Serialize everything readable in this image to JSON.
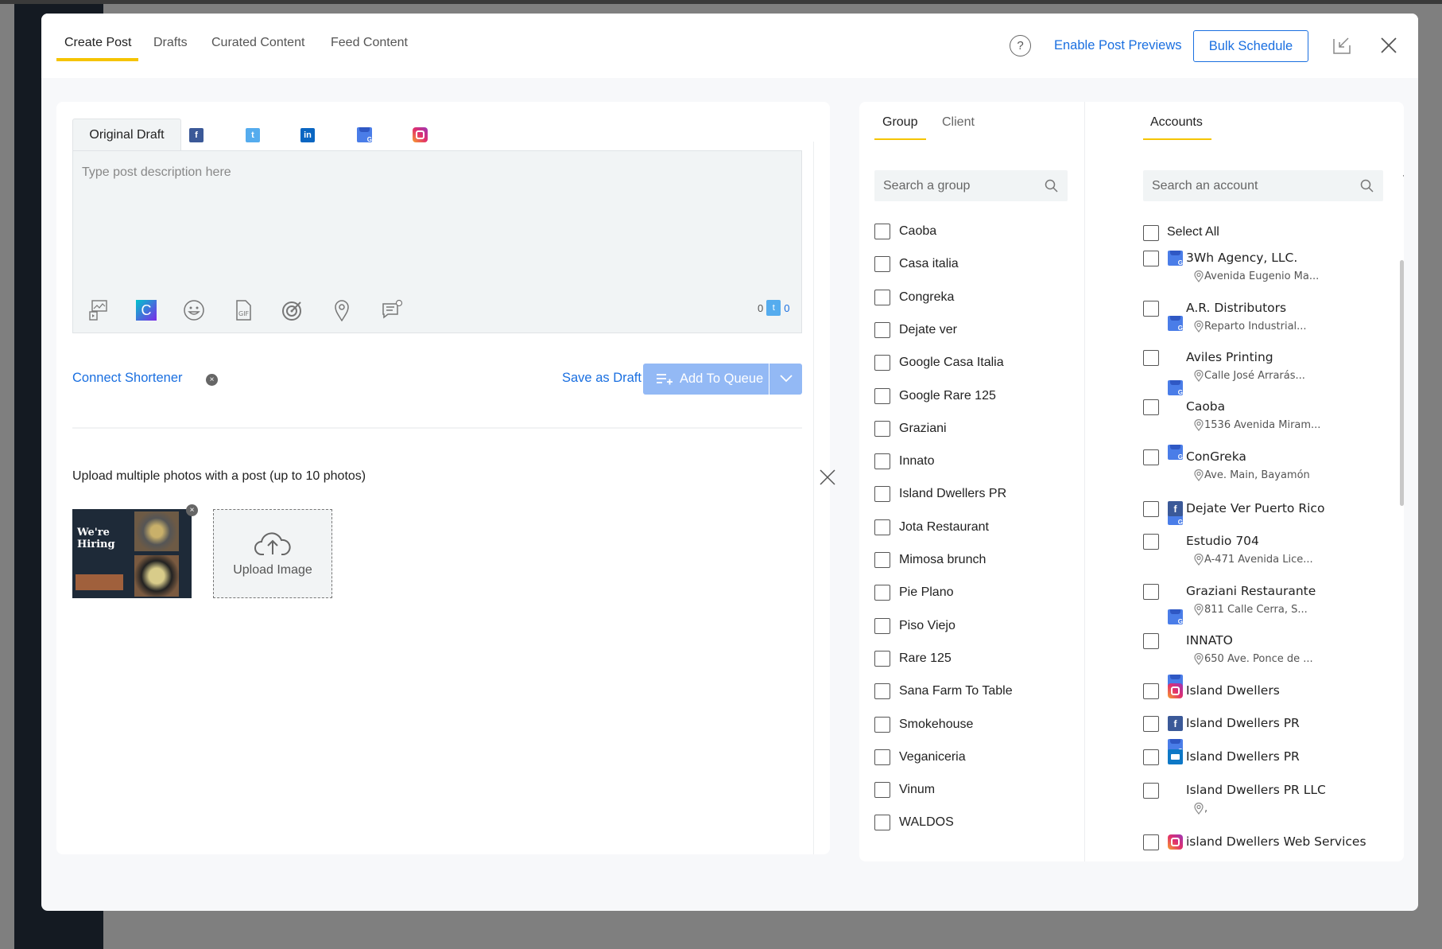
{
  "header": {
    "tabs": [
      {
        "label": "Create Post",
        "active": true
      },
      {
        "label": "Drafts"
      },
      {
        "label": "Curated Content"
      },
      {
        "label": "Feed Content"
      }
    ],
    "enable_previews": "Enable Post Previews",
    "bulk_schedule": "Bulk Schedule"
  },
  "composer": {
    "draft_tab": "Original Draft",
    "network_tabs": [
      "facebook",
      "twitter",
      "linkedin",
      "google-business",
      "instagram"
    ],
    "placeholder": "Type post description here",
    "counter_left": "0",
    "counter_right": "0",
    "connect_shortener": "Connect Shortener",
    "save_draft": "Save as Draft",
    "add_to_queue": "Add To Queue"
  },
  "upload": {
    "title": "Upload multiple photos with a post (up to 10 photos)",
    "thumb_text": "We're Hiring",
    "upload_label": "Upload Image"
  },
  "groups": {
    "tabs": [
      "Group",
      "Client"
    ],
    "search_placeholder": "Search a group",
    "items": [
      "Caoba",
      "Casa italia",
      "Congreka",
      "Dejate ver",
      "Google Casa Italia",
      "Google Rare 125",
      "Graziani",
      "Innato",
      "Island Dwellers PR",
      "Jota Restaurant",
      "Mimosa brunch",
      "Pie Plano",
      "Piso Viejo",
      "Rare 125",
      "Sana Farm To Table",
      "Smokehouse",
      "Veganiceria",
      "Vinum",
      "WALDOS"
    ]
  },
  "accounts": {
    "tab": "Accounts",
    "search_placeholder": "Search an account",
    "select_all": "Select All",
    "items": [
      {
        "name": "3Wh Agency, LLC.",
        "network": "google-business",
        "address": "Avenida Eugenio Ma..."
      },
      {
        "name": "A.R. Distributors",
        "network": "google-business",
        "address": "Reparto Industrial..."
      },
      {
        "name": "Aviles Printing",
        "network": "google-business",
        "address": "Calle José Arrarás..."
      },
      {
        "name": "Caoba",
        "network": "google-business",
        "address": "1536 Avenida Miram..."
      },
      {
        "name": "ConGreka",
        "network": "google-business",
        "address": "Ave. Main, Bayamón"
      },
      {
        "name": "Dejate Ver Puerto Rico",
        "network": "facebook"
      },
      {
        "name": "Estudio 704",
        "network": "google-business",
        "address": "A-471 Avenida Lice..."
      },
      {
        "name": "Graziani Restaurante",
        "network": "google-business",
        "address": "811 Calle Cerra, S..."
      },
      {
        "name": "INNATO",
        "network": "google-business",
        "address": "650 Ave. Ponce de ..."
      },
      {
        "name": "Island Dwellers",
        "network": "instagram"
      },
      {
        "name": "Island Dwellers PR",
        "network": "facebook"
      },
      {
        "name": "Island Dwellers PR",
        "network": "business-profile"
      },
      {
        "name": "Island Dwellers PR LLC",
        "network": "google-business",
        "address": ","
      },
      {
        "name": "island Dwellers Web Services",
        "network": "instagram"
      }
    ]
  },
  "colors": {
    "accent": "#1a6fe0",
    "tab_underline": "#f5c400",
    "queue_button": "#93b9f5"
  }
}
